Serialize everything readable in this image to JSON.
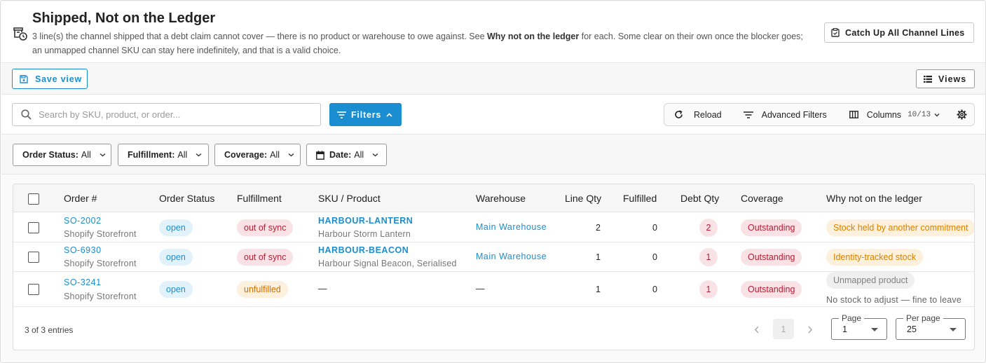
{
  "header": {
    "title": "Shipped, Not on the Ledger",
    "desc_before": "3 line(s) the channel shipped that a debt claim cannot cover — there is no product or warehouse to owe against. See ",
    "desc_bold": "Why not on the ledger",
    "desc_after": " for each. Some clear on their own once the blocker goes; an unmapped channel SKU can stay here indefinitely, and that is a valid choice.",
    "catchup_label": "Catch Up All Channel Lines"
  },
  "viewbar": {
    "save_label": "Save view",
    "views_label": "Views"
  },
  "search": {
    "placeholder": "Search by SKU, product, or order..."
  },
  "filters_label": "Filters",
  "toolbar": {
    "reload_label": "Reload",
    "advanced_label": "Advanced Filters",
    "columns_label": "Columns",
    "columns_count": "10/13"
  },
  "chips": [
    {
      "key": "Order Status:",
      "value": "All"
    },
    {
      "key": "Fulfillment:",
      "value": "All"
    },
    {
      "key": "Coverage:",
      "value": "All"
    },
    {
      "key": "Date:",
      "value": "All"
    }
  ],
  "table": {
    "columns": [
      "Order #",
      "Order Status",
      "Fulfillment",
      "SKU / Product",
      "Warehouse",
      "Line Qty",
      "Fulfilled",
      "Debt Qty",
      "Coverage",
      "Why not on the ledger"
    ],
    "rows": [
      {
        "order": "SO-2002",
        "channel": "Shopify Storefront",
        "status": "open",
        "fulfillment": "out of sync",
        "sku": "HARBOUR-LANTERN",
        "product": "Harbour Storm Lantern",
        "warehouse": "Main Warehouse",
        "line_qty": "2",
        "fulfilled": "0",
        "debt_qty": "2",
        "coverage": "Outstanding",
        "why": "Stock held by another commitment",
        "why_note": ""
      },
      {
        "order": "SO-6930",
        "channel": "Shopify Storefront",
        "status": "open",
        "fulfillment": "out of sync",
        "sku": "HARBOUR-BEACON",
        "product": "Harbour Signal Beacon, Serialised",
        "warehouse": "Main Warehouse",
        "line_qty": "1",
        "fulfilled": "0",
        "debt_qty": "1",
        "coverage": "Outstanding",
        "why": "Identity-tracked stock",
        "why_note": ""
      },
      {
        "order": "SO-3241",
        "channel": "Shopify Storefront",
        "status": "open",
        "fulfillment": "unfulfilled",
        "sku": "—",
        "product": "",
        "warehouse": "—",
        "line_qty": "1",
        "fulfilled": "0",
        "debt_qty": "1",
        "coverage": "Outstanding",
        "why": "Unmapped product",
        "why_note": "No stock to adjust — fine to leave"
      }
    ]
  },
  "footer": {
    "entries": "3 of 3 entries",
    "current_page": "1",
    "page_label": "Page",
    "page_value": "1",
    "per_page_label": "Per page",
    "per_page_value": "25"
  },
  "colors": {
    "accent": "#1a8ed0",
    "danger": "#b31f34",
    "warning": "#d98100"
  }
}
